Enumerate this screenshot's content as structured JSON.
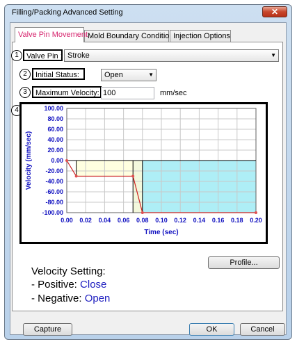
{
  "window": {
    "title": "Filling/Packing Advanced Setting",
    "close_glyph": "✕"
  },
  "tabs": [
    {
      "label": "Valve Pin Movement",
      "active": true
    },
    {
      "label": "Mold Boundary Condition",
      "active": false
    },
    {
      "label": "Injection Options",
      "active": false
    }
  ],
  "markers": [
    "1",
    "2",
    "3",
    "4"
  ],
  "valve_pin": {
    "label": "Valve Pin :",
    "value": "Stroke"
  },
  "initial_status": {
    "label": "Initial Status:",
    "value": "Open"
  },
  "max_velocity": {
    "label": "Maximum Velocity:",
    "value": "100",
    "unit": "mm/sec"
  },
  "buttons": {
    "profile": "Profile...",
    "capture": "Capture",
    "ok": "OK",
    "cancel": "Cancel"
  },
  "velocity_setting": {
    "heading": "Velocity Setting:",
    "positive_label": "- Positive: ",
    "positive_value": "Close",
    "negative_label": "- Negative: ",
    "negative_value": "Open"
  },
  "chart_data": {
    "type": "line",
    "xlabel": "Time (sec)",
    "ylabel": "Velocity (mm/sec)",
    "xlim": [
      0,
      0.2
    ],
    "ylim": [
      -100,
      100
    ],
    "x_ticks": [
      "0.00",
      "0.02",
      "0.04",
      "0.06",
      "0.08",
      "0.10",
      "0.12",
      "0.14",
      "0.16",
      "0.18",
      "0.20"
    ],
    "y_ticks": [
      "100.00",
      "80.00",
      "60.00",
      "40.00",
      "20.00",
      "0.00",
      "-20.00",
      "-40.00",
      "-60.00",
      "-80.00",
      "-100.00"
    ],
    "grid": true,
    "series": [
      {
        "x": [
          0,
          0.01,
          0.07,
          0.08,
          0.2
        ],
        "y": [
          0,
          -30,
          -30,
          -100,
          -100
        ]
      }
    ],
    "fills": [
      {
        "x0": 0.01,
        "x1": 0.07,
        "y0": -30,
        "y1": 0,
        "color": "#ffffe0"
      },
      {
        "x0": 0.07,
        "x1": 0.08,
        "y0": -100,
        "y1": 0,
        "color": "#f3f8dc"
      },
      {
        "x0": 0.08,
        "x1": 0.2,
        "y0": -100,
        "y1": 0,
        "color": "#aeeef6"
      }
    ],
    "colors": {
      "line": "#cc2020",
      "axis_text": "#1010c0",
      "grid": "#c8c8c8",
      "points": "#e05050"
    }
  }
}
